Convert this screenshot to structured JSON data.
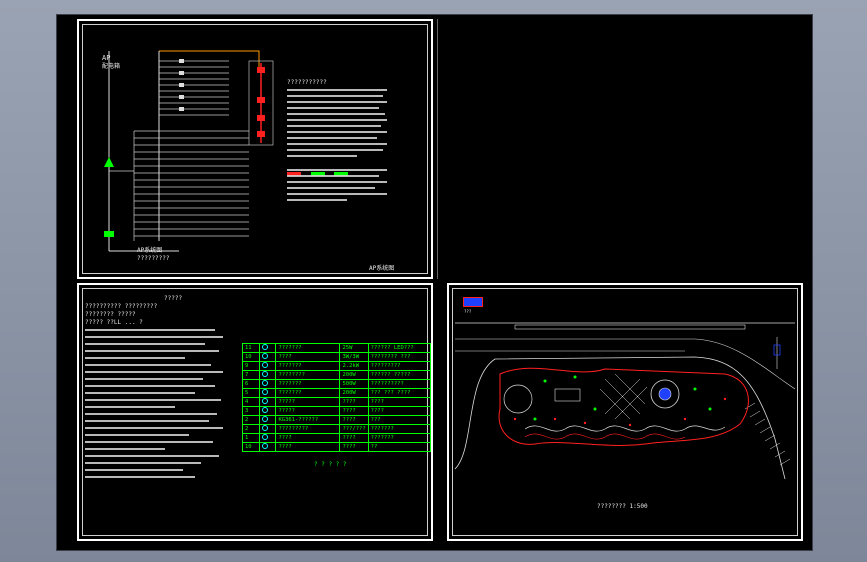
{
  "colors": {
    "background": "#000000",
    "sheet_border": "#ffffff",
    "cad_green": "#00ff00",
    "cad_red": "#ff2020",
    "cad_orange": "#ff9900",
    "cad_blue": "#2040ff"
  },
  "sheet1": {
    "panel_label": "AP",
    "panel_sublabel": "配电箱",
    "caption_main": "AP系统图",
    "caption_sub": "?????????",
    "notes_title": "???????????",
    "notes_footer": "AP系统图"
  },
  "sheet3": {
    "intro_title": "?????",
    "header_lines": [
      "?????????? ?????????",
      "???????? ?????"
    ],
    "spec_line1": "????? ??LL ... ?"
  },
  "legend": {
    "rows": [
      {
        "no": "11",
        "name": "???????",
        "power": "25W",
        "desc": "?????? LED???"
      },
      {
        "no": "10",
        "name": "????",
        "power": "3W/3W",
        "desc": "???????? ???"
      },
      {
        "no": "9",
        "name": "???????",
        "power": "2.2kW",
        "desc": "?????????"
      },
      {
        "no": "7",
        "name": "????????",
        "power": "200W",
        "desc": "?????? ?????"
      },
      {
        "no": "6",
        "name": "???????",
        "power": "500W",
        "desc": "??????????"
      },
      {
        "no": "5",
        "name": "???????",
        "power": "200W",
        "desc": "??? ??? ????"
      },
      {
        "no": "4",
        "name": "?????",
        "power": "????",
        "desc": "????"
      },
      {
        "no": "3",
        "name": "?????",
        "power": "????",
        "desc": "????"
      },
      {
        "no": "2",
        "name": "KG361-??????",
        "power": "????",
        "desc": "???"
      },
      {
        "no": "2",
        "name": "?????????",
        "power": "???/???",
        "desc": "???????"
      },
      {
        "no": "1",
        "name": "????",
        "power": "????",
        "desc": "???????"
      },
      {
        "no": "10",
        "name": "????",
        "power": "????",
        "desc": "??"
      }
    ],
    "footer": "? ? ? ? ?"
  },
  "sheet4": {
    "tag": "???",
    "scale_caption": "????????  1:500"
  }
}
